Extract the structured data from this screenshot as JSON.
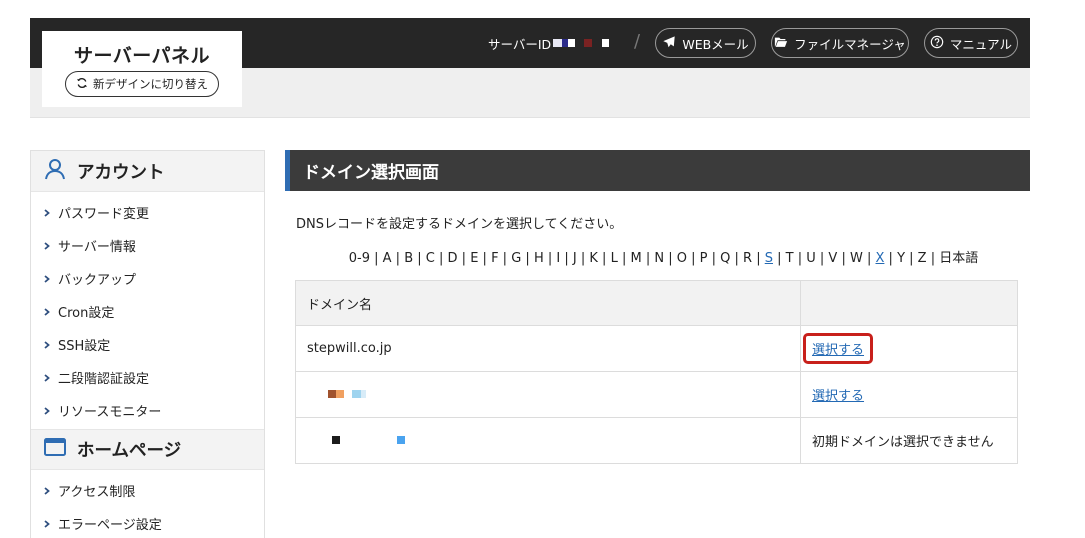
{
  "header": {
    "logo_title": "サーバーパネル",
    "switch_label": "新デザインに切り替え",
    "server_id_label": "サーバーID",
    "slash": "/",
    "webmail_label": "WEBメール",
    "filemanager_label": "ファイルマネージャ",
    "manual_label": "マニュアル"
  },
  "sidebar": {
    "account_heading": "アカウント",
    "account_items": [
      {
        "label": "パスワード変更"
      },
      {
        "label": "サーバー情報"
      },
      {
        "label": "バックアップ"
      },
      {
        "label": "Cron設定"
      },
      {
        "label": "SSH設定"
      },
      {
        "label": "二段階認証設定"
      },
      {
        "label": "リソースモニター"
      }
    ],
    "homepage_heading": "ホームページ",
    "homepage_items": [
      {
        "label": "アクセス制限"
      },
      {
        "label": "エラーページ設定"
      }
    ]
  },
  "main": {
    "title": "ドメイン選択画面",
    "description": "DNSレコードを設定するドメインを選択してください。",
    "alpha_index": [
      "0-9",
      "A",
      "B",
      "C",
      "D",
      "E",
      "F",
      "G",
      "H",
      "I",
      "J",
      "K",
      "L",
      "M",
      "N",
      "O",
      "P",
      "Q",
      "R",
      "S",
      "T",
      "U",
      "V",
      "W",
      "X",
      "Y",
      "Z",
      "日本語"
    ],
    "alpha_links": [
      "S",
      "X"
    ],
    "table": {
      "header_domain": "ドメイン名",
      "header_action": "",
      "rows": [
        {
          "domain": "stepwill.co.jp",
          "action": "選択する"
        },
        {
          "domain": "",
          "action": "選択する"
        },
        {
          "domain": "",
          "action": "初期ドメインは選択できません"
        }
      ]
    }
  },
  "colors": {
    "header_bg": "#262626",
    "title_accent": "#2f6db3",
    "link": "#2369b4",
    "highlight_border": "#c8201b"
  }
}
